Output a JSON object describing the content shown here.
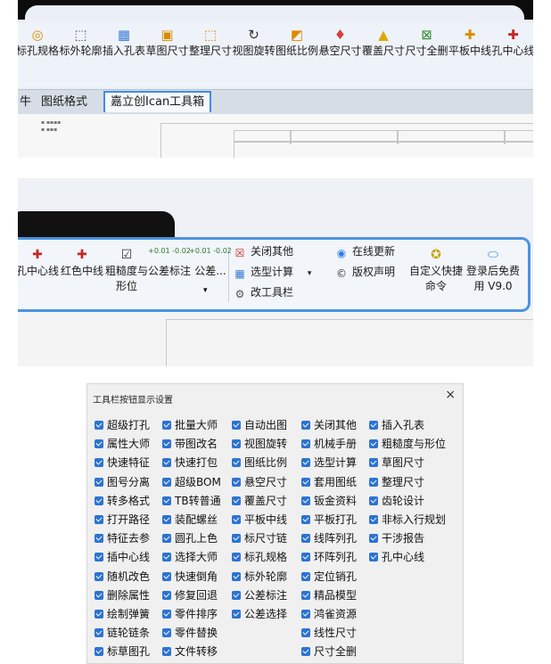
{
  "panel1": {
    "tools": [
      {
        "label": "标孔规格",
        "icon": "hole-spec-icon",
        "glyph": "◎"
      },
      {
        "label": "标外轮廓",
        "icon": "outline-icon",
        "glyph": "⬚"
      },
      {
        "label": "插入孔表",
        "icon": "table-icon",
        "glyph": "▦"
      },
      {
        "label": "草图尺寸",
        "icon": "sketch-dim-icon",
        "glyph": "▣"
      },
      {
        "label": "整理尺寸",
        "icon": "arrange-dim-icon",
        "glyph": "⬚"
      },
      {
        "label": "视图旋转",
        "icon": "rotate-icon",
        "glyph": "↻"
      },
      {
        "label": "图纸比例",
        "icon": "scale-icon",
        "glyph": "◩"
      },
      {
        "label": "悬空尺寸",
        "icon": "dangling-dim-icon",
        "glyph": "♦"
      },
      {
        "label": "覆盖尺寸",
        "icon": "warning-icon",
        "glyph": "▲"
      },
      {
        "label": "尺寸全删",
        "icon": "delete-dim-icon",
        "glyph": "⊠"
      },
      {
        "label": "平板中线",
        "icon": "centerline-icon",
        "glyph": "✚"
      },
      {
        "label": "孔中心线",
        "icon": "hole-center-icon",
        "glyph": "✚"
      }
    ],
    "tabs": [
      "牛",
      "图纸格式",
      "嘉立创Ican工具箱"
    ]
  },
  "panel2": {
    "tools_left": [
      {
        "label": "孔中心线",
        "icon": "hole-center-icon",
        "glyph": "✚"
      },
      {
        "label": "红色中线",
        "icon": "red-centerline-icon",
        "glyph": "✚"
      },
      {
        "label": "粗糙度与形位",
        "icon": "roughness-icon",
        "glyph": "☑"
      },
      {
        "label": "公差标注",
        "icon": "tolerance-icon",
        "tol": "+0.01 -0.02"
      },
      {
        "label": "公差...",
        "icon": "tolerance2-icon",
        "tol": "+0.01 -0.02"
      }
    ],
    "middle": [
      {
        "label": "关闭其他",
        "icon": "close-others-icon",
        "glyph": "☒"
      },
      {
        "label": "选型计算",
        "icon": "calc-icon",
        "glyph": "▦"
      },
      {
        "label": "改工具栏",
        "icon": "gear-icon",
        "glyph": "⚙"
      }
    ],
    "right": [
      {
        "label": "在线更新",
        "icon": "update-icon",
        "glyph": "◉"
      },
      {
        "label": "版权声明",
        "icon": "copyright-icon",
        "glyph": "©"
      }
    ],
    "tools_right": [
      {
        "label": "自定义快捷命令",
        "icon": "custom-command-icon",
        "glyph": "✪"
      },
      {
        "label": "登录后免费用 V9.0",
        "icon": "login-icon",
        "glyph": "⬭"
      }
    ]
  },
  "dialog": {
    "title": "工具栏按钮显示设置",
    "close": "×",
    "columns": [
      [
        "超级打孔",
        "属性大师",
        "快速特征",
        "图号分离",
        "转多格式",
        "打开路径",
        "特征去参",
        "插中心线",
        "随机改色",
        "删除属性",
        "绘制弹簧",
        "链轮链条",
        "标草图孔"
      ],
      [
        "批量大师",
        "带图改名",
        "快速打包",
        "超级BOM",
        "TB转普通",
        "装配螺丝",
        "圆孔上色",
        "选择大师",
        "快速倒角",
        "修复回退",
        "零件排序",
        "零件替换",
        "文件转移"
      ],
      [
        "自动出图",
        "视图旋转",
        "图纸比例",
        "悬空尺寸",
        "覆盖尺寸",
        "平板中线",
        "标尺寸链",
        "标孔规格",
        "标外轮廓",
        "公差标注",
        "公差选择"
      ],
      [
        "关闭其他",
        "机械手册",
        "选型计算",
        "套用图纸",
        "钣金资料",
        "平板打孔",
        "线阵列孔",
        "环阵列孔",
        "定位销孔",
        "精品模型",
        "鸿雀资源",
        "线性尺寸",
        "尺寸全删"
      ],
      [
        "插入孔表",
        "粗糙度与形位",
        "草图尺寸",
        "整理尺寸",
        "齿轮设计",
        "非标入行规划",
        "干涉报告",
        "孔中心线"
      ]
    ]
  }
}
